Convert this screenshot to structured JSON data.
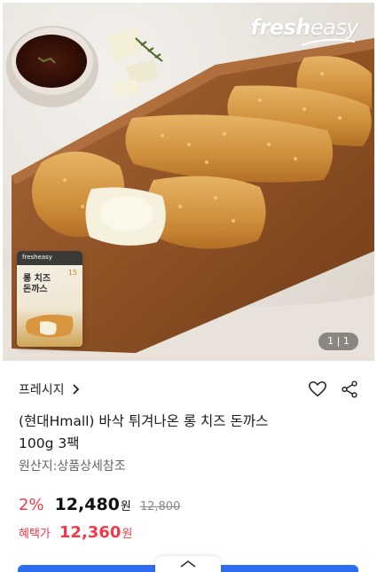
{
  "hero": {
    "brand_bold": "fresh",
    "brand_light": "easy",
    "package": {
      "logo": "fresheasy",
      "title": "롱 치즈 돈까스",
      "number": "15"
    },
    "image_counter": "1 | 1"
  },
  "seller": {
    "name": "프레시지"
  },
  "product": {
    "title_line1": "(현대Hmall) 바삭 튀겨나온 롱 치즈 돈까스",
    "title_line2": "100g 3팩",
    "origin": "원산지:상품상세참조"
  },
  "pricing": {
    "discount": "2%",
    "price": "12,480",
    "currency": "원",
    "original_price": "12,800",
    "benefit_label": "혜택가",
    "benefit_price": "12,360",
    "benefit_currency": "원"
  },
  "colors": {
    "accent_red": "#f0394b",
    "accent_blue": "#2f6df0"
  },
  "icons": {
    "seller_chevron": "chevron-right-icon",
    "wishlist": "heart-icon",
    "share": "share-icon",
    "expand": "chevron-up-icon"
  }
}
